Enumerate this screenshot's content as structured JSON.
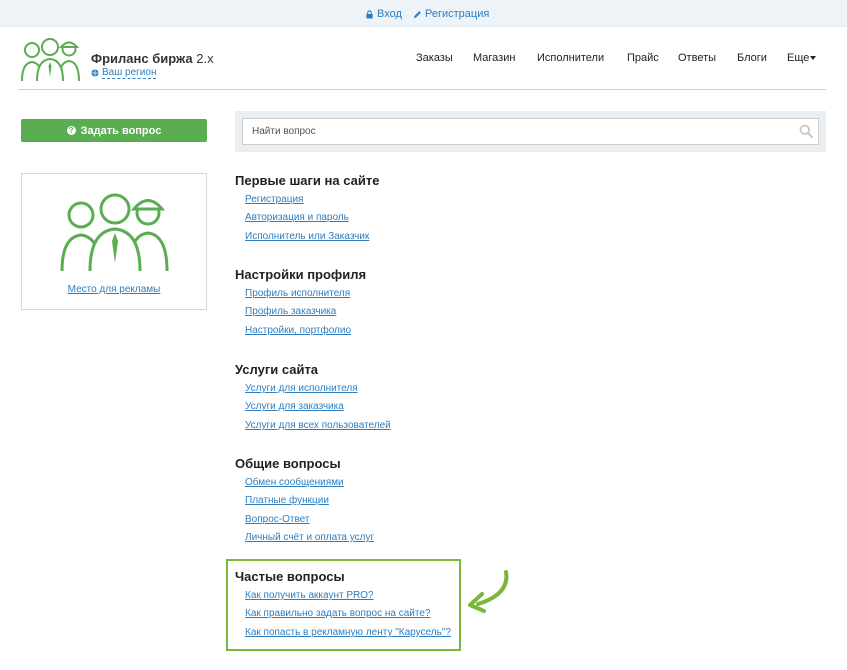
{
  "topbar": {
    "login_label": "Вход",
    "register_label": "Регистрация"
  },
  "header": {
    "brand_name": "Фриланс биржа",
    "brand_version": "2.х",
    "region_label": "Ваш регион"
  },
  "nav": {
    "items": [
      "Заказы",
      "Магазин",
      "Исполнители",
      "Прайс",
      "Ответы",
      "Блоги",
      "Еще"
    ]
  },
  "sidebar": {
    "ask_button_label": "Задать вопрос",
    "ad_link_label": "Место для рекламы"
  },
  "search": {
    "placeholder": "Найти вопрос"
  },
  "sections": [
    {
      "title": "Первые шаги на сайте",
      "links": [
        "Регистрация",
        "Авторизация и пароль",
        "Исполнитель или Заказчик"
      ]
    },
    {
      "title": "Настройки профиля",
      "links": [
        "Профиль исполнителя",
        "Профиль заказчика",
        "Настройки, портфолио"
      ]
    },
    {
      "title": "Услуги сайта",
      "links": [
        "Услуги для исполнителя",
        "Услуги для заказчика",
        "Услуги для всех пользователей"
      ]
    },
    {
      "title": "Общие вопросы",
      "links": [
        "Обмен сообщениями",
        "Платные функции",
        "Вопрос-Ответ",
        "Личный счёт и оплата услуг"
      ]
    },
    {
      "title": "Частые вопросы",
      "links": [
        "Как получить аккаунт PRO?",
        "Как правильно задать вопрос на сайте?",
        "Как попасть в рекламную ленту \"Карусель\"?"
      ]
    }
  ],
  "colors": {
    "accent_green": "#5aad50",
    "highlight_green": "#7ab73a",
    "link_blue": "#2d7ec0"
  },
  "icons": {
    "lock": "lock-icon",
    "pencil": "pencil-icon",
    "globe": "globe-icon",
    "question": "question-circle-icon",
    "search": "search-icon",
    "caret": "caret-down-icon",
    "arrow": "green-arrow-icon"
  }
}
